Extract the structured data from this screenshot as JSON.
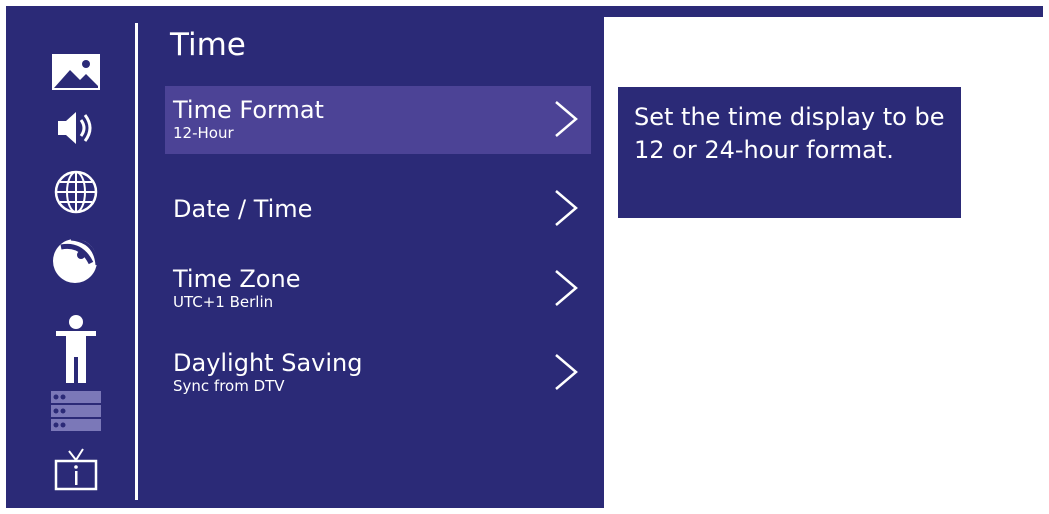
{
  "sidebar": {
    "items": [
      {
        "icon": "picture-icon"
      },
      {
        "icon": "sound-icon"
      },
      {
        "icon": "globe-icon"
      },
      {
        "icon": "satellite-dish-icon"
      },
      {
        "icon": "person-icon"
      },
      {
        "icon": "channel-list-icon"
      },
      {
        "icon": "tv-info-icon"
      }
    ]
  },
  "menu": {
    "title": "Time",
    "items": [
      {
        "label": "Time Format",
        "value": "12-Hour"
      },
      {
        "label": "Date / Time",
        "value": ""
      },
      {
        "label": "Time Zone",
        "value": "UTC+1 Berlin"
      },
      {
        "label": "Daylight Saving",
        "value": "Sync from DTV"
      }
    ]
  },
  "help": {
    "text": "Set the time display to be 12 or 24-hour format."
  },
  "colors": {
    "background": "#2b2a77",
    "selected": "#4c4396",
    "text": "#ffffff"
  }
}
